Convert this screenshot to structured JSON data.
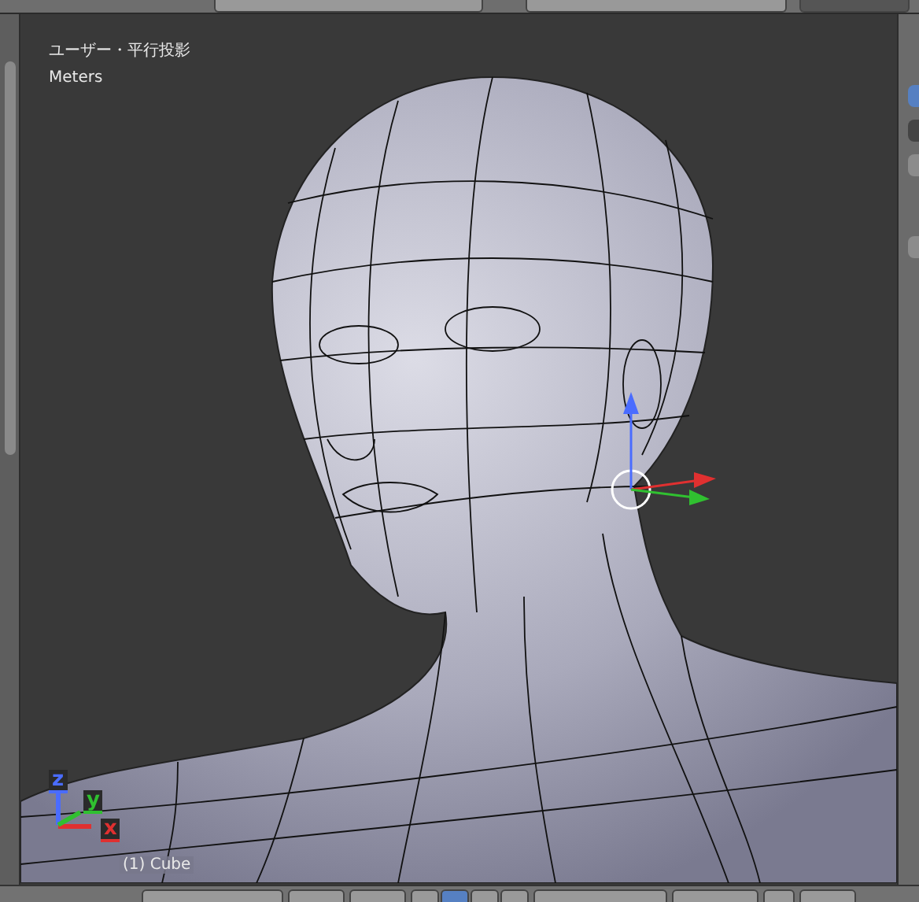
{
  "viewport": {
    "view_label": "ユーザー・平行投影",
    "units": "Meters",
    "object_label": "(1) Cube",
    "axes": [
      {
        "label": "z",
        "color": "#4a6cff"
      },
      {
        "label": "x",
        "color": "#e03030"
      },
      {
        "label": "y",
        "color": "#30c030"
      }
    ]
  },
  "header": {
    "transform_toggles": [
      {
        "on": false
      },
      {
        "on": true
      },
      {
        "on": false
      },
      {
        "on": false
      }
    ],
    "occlude_toggle": {
      "on": false
    }
  }
}
